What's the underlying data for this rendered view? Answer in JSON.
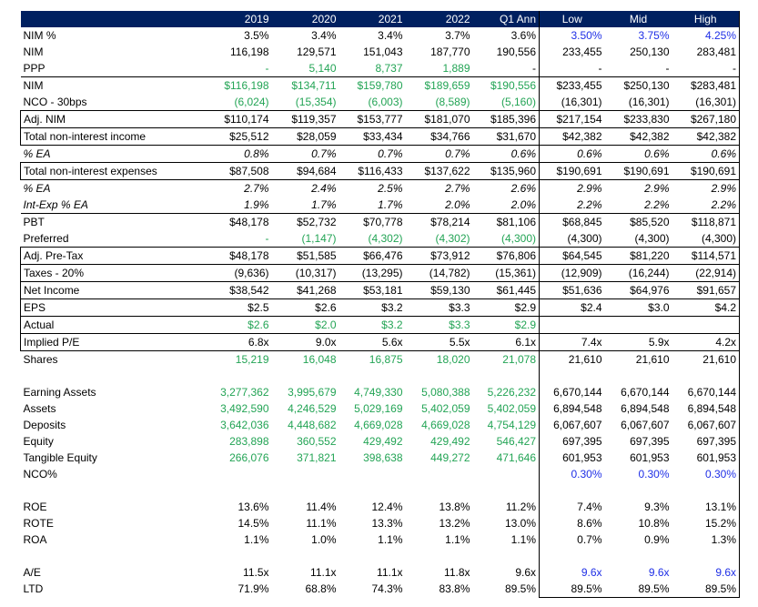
{
  "header": [
    "",
    "2019",
    "2020",
    "2021",
    "2022",
    "Q1 Ann",
    "Low",
    "Mid",
    "High"
  ],
  "rows": [
    {
      "label": "NIM %",
      "cells": [
        "3.5%",
        "3.4%",
        "3.4%",
        "3.7%",
        "3.6%",
        "3.50%",
        "3.75%",
        "4.25%"
      ],
      "color": [
        "",
        "",
        "",
        "",
        "",
        "blue",
        "blue",
        "blue"
      ]
    },
    {
      "label": "NIM",
      "cells": [
        "116,198",
        "129,571",
        "151,043",
        "187,770",
        "190,556",
        "233,455",
        "250,130",
        "283,481"
      ]
    },
    {
      "label": "PPP",
      "cells": [
        "-",
        "5,140",
        "8,737",
        "1,889",
        "-",
        "-",
        "-",
        "-"
      ],
      "color": [
        "green",
        "green",
        "green",
        "green",
        "",
        "",
        "",
        ""
      ]
    },
    {
      "label": "NIM",
      "cells": [
        "$116,198",
        "$134,711",
        "$159,780",
        "$189,659",
        "$190,556",
        "$233,455",
        "$250,130",
        "$283,481"
      ],
      "color": [
        "green",
        "green",
        "green",
        "green",
        "green",
        "",
        "",
        ""
      ]
    },
    {
      "label": "NCO - 30bps",
      "cells": [
        "(6,024)",
        "(15,354)",
        "(6,003)",
        "(8,589)",
        "(5,160)",
        "(16,301)",
        "(16,301)",
        "(16,301)"
      ],
      "color": [
        "green",
        "green",
        "green",
        "green",
        "green",
        "",
        "",
        ""
      ]
    },
    {
      "label": "Adj. NIM",
      "cells": [
        "$110,174",
        "$119,357",
        "$153,777",
        "$181,070",
        "$185,396",
        "$217,154",
        "$233,830",
        "$267,180"
      ]
    },
    {
      "label": "Total non-interest income",
      "cells": [
        "$25,512",
        "$28,059",
        "$33,434",
        "$34,766",
        "$31,670",
        "$42,382",
        "$42,382",
        "$42,382"
      ]
    },
    {
      "label": "% EA",
      "cells": [
        "0.8%",
        "0.7%",
        "0.7%",
        "0.7%",
        "0.6%",
        "0.6%",
        "0.6%",
        "0.6%"
      ]
    },
    {
      "label": "Total non-interest expenses",
      "cells": [
        "$87,508",
        "$94,684",
        "$116,433",
        "$137,622",
        "$135,960",
        "$190,691",
        "$190,691",
        "$190,691"
      ]
    },
    {
      "label": "% EA",
      "cells": [
        "2.7%",
        "2.4%",
        "2.5%",
        "2.7%",
        "2.6%",
        "2.9%",
        "2.9%",
        "2.9%"
      ]
    },
    {
      "label": "Int-Exp % EA",
      "cells": [
        "1.9%",
        "1.7%",
        "1.7%",
        "2.0%",
        "2.0%",
        "2.2%",
        "2.2%",
        "2.2%"
      ]
    },
    {
      "label": "PBT",
      "cells": [
        "$48,178",
        "$52,732",
        "$70,778",
        "$78,214",
        "$81,106",
        "$68,845",
        "$85,520",
        "$118,871"
      ]
    },
    {
      "label": "Preferred",
      "cells": [
        "-",
        "(1,147)",
        "(4,302)",
        "(4,302)",
        "(4,300)",
        "(4,300)",
        "(4,300)",
        "(4,300)"
      ],
      "color": [
        "green",
        "green",
        "green",
        "green",
        "green",
        "",
        "",
        ""
      ]
    },
    {
      "label": "Adj. Pre-Tax",
      "cells": [
        "$48,178",
        "$51,585",
        "$66,476",
        "$73,912",
        "$76,806",
        "$64,545",
        "$81,220",
        "$114,571"
      ]
    },
    {
      "label": "Taxes - 20%",
      "cells": [
        "(9,636)",
        "(10,317)",
        "(13,295)",
        "(14,782)",
        "(15,361)",
        "(12,909)",
        "(16,244)",
        "(22,914)"
      ]
    },
    {
      "label": "Net Income",
      "cells": [
        "$38,542",
        "$41,268",
        "$53,181",
        "$59,130",
        "$61,445",
        "$51,636",
        "$64,976",
        "$91,657"
      ]
    },
    {
      "label": "EPS",
      "cells": [
        "$2.5",
        "$2.6",
        "$3.2",
        "$3.3",
        "$2.9",
        "$2.4",
        "$3.0",
        "$4.2"
      ]
    },
    {
      "label": "Actual",
      "cells": [
        "$2.6",
        "$2.0",
        "$3.2",
        "$3.3",
        "$2.9",
        "",
        "",
        ""
      ],
      "color": [
        "green",
        "green",
        "green",
        "green",
        "green",
        "",
        "",
        ""
      ]
    },
    {
      "label": "Implied P/E",
      "cells": [
        "6.8x",
        "9.0x",
        "5.6x",
        "5.5x",
        "6.1x",
        "7.4x",
        "5.9x",
        "4.2x"
      ]
    },
    {
      "label": "Shares",
      "cells": [
        "15,219",
        "16,048",
        "16,875",
        "18,020",
        "21,078",
        "21,610",
        "21,610",
        "21,610"
      ],
      "color": [
        "green",
        "green",
        "green",
        "green",
        "green",
        "",
        "",
        ""
      ]
    },
    {
      "label": "",
      "cells": [
        "",
        "",
        "",
        "",
        "",
        "",
        "",
        ""
      ]
    },
    {
      "label": "Earning Assets",
      "cells": [
        "3,277,362",
        "3,995,679",
        "4,749,330",
        "5,080,388",
        "5,226,232",
        "6,670,144",
        "6,670,144",
        "6,670,144"
      ],
      "color": [
        "green",
        "green",
        "green",
        "green",
        "green",
        "",
        "",
        ""
      ]
    },
    {
      "label": "Assets",
      "cells": [
        "3,492,590",
        "4,246,529",
        "5,029,169",
        "5,402,059",
        "5,402,059",
        "6,894,548",
        "6,894,548",
        "6,894,548"
      ],
      "color": [
        "green",
        "green",
        "green",
        "green",
        "green",
        "",
        "",
        ""
      ]
    },
    {
      "label": "Deposits",
      "cells": [
        "3,642,036",
        "4,448,682",
        "4,669,028",
        "4,669,028",
        "4,754,129",
        "6,067,607",
        "6,067,607",
        "6,067,607"
      ],
      "color": [
        "green",
        "green",
        "green",
        "green",
        "green",
        "",
        "",
        ""
      ]
    },
    {
      "label": "Equity",
      "cells": [
        "283,898",
        "360,552",
        "429,492",
        "429,492",
        "546,427",
        "697,395",
        "697,395",
        "697,395"
      ],
      "color": [
        "green",
        "green",
        "green",
        "green",
        "green",
        "",
        "",
        ""
      ]
    },
    {
      "label": "Tangible Equity",
      "cells": [
        "266,076",
        "371,821",
        "398,638",
        "449,272",
        "471,646",
        "601,953",
        "601,953",
        "601,953"
      ],
      "color": [
        "green",
        "green",
        "green",
        "green",
        "green",
        "",
        "",
        ""
      ]
    },
    {
      "label": "NCO%",
      "cells": [
        "",
        "",
        "",
        "",
        "",
        "0.30%",
        "0.30%",
        "0.30%"
      ],
      "color": [
        "",
        "",
        "",
        "",
        "",
        "blue",
        "blue",
        "blue"
      ]
    },
    {
      "label": "",
      "cells": [
        "",
        "",
        "",
        "",
        "",
        "",
        "",
        ""
      ]
    },
    {
      "label": "ROE",
      "cells": [
        "13.6%",
        "11.4%",
        "12.4%",
        "13.8%",
        "11.2%",
        "7.4%",
        "9.3%",
        "13.1%"
      ]
    },
    {
      "label": "ROTE",
      "cells": [
        "14.5%",
        "11.1%",
        "13.3%",
        "13.2%",
        "13.0%",
        "8.6%",
        "10.8%",
        "15.2%"
      ]
    },
    {
      "label": "ROA",
      "cells": [
        "1.1%",
        "1.0%",
        "1.1%",
        "1.1%",
        "1.1%",
        "0.7%",
        "0.9%",
        "1.3%"
      ]
    },
    {
      "label": "",
      "cells": [
        "",
        "",
        "",
        "",
        "",
        "",
        "",
        ""
      ]
    },
    {
      "label": "A/E",
      "cells": [
        "11.5x",
        "11.1x",
        "11.1x",
        "11.8x",
        "9.6x",
        "9.6x",
        "9.6x",
        "9.6x"
      ],
      "color": [
        "",
        "",
        "",
        "",
        "",
        "blue",
        "blue",
        "blue"
      ]
    },
    {
      "label": "LTD",
      "cells": [
        "71.9%",
        "68.8%",
        "74.3%",
        "83.8%",
        "89.5%",
        "89.5%",
        "89.5%",
        "89.5%"
      ]
    }
  ]
}
